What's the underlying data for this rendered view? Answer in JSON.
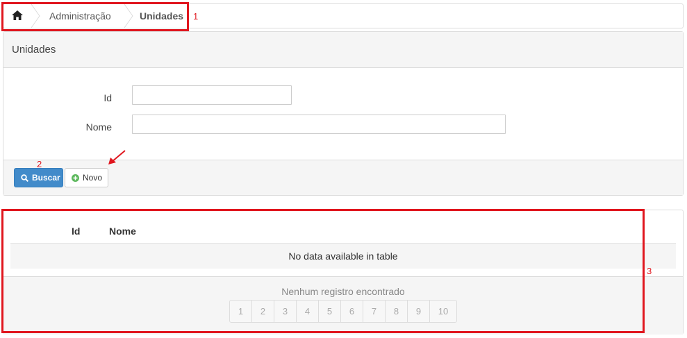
{
  "breadcrumb": {
    "home_icon": "home-icon",
    "items": [
      {
        "label": "Administração"
      },
      {
        "label": "Unidades"
      }
    ]
  },
  "panel": {
    "title": "Unidades",
    "fields": [
      {
        "label": "Id",
        "value": "",
        "placeholder": ""
      },
      {
        "label": "Nome",
        "value": "",
        "placeholder": ""
      }
    ],
    "buttons": {
      "search": {
        "label": "Buscar",
        "icon": "search-icon",
        "color": "#428bca"
      },
      "new": {
        "label": "Novo",
        "icon": "plus-circle-icon",
        "icon_color": "#5cb85c"
      }
    }
  },
  "table": {
    "columns": [
      "Id",
      "Nome"
    ],
    "empty_message": "No data available in table",
    "records_info": "Nenhum registro encontrado",
    "pages": [
      "1",
      "2",
      "3",
      "4",
      "5",
      "6",
      "7",
      "8",
      "9",
      "10"
    ]
  },
  "annotations": {
    "color": "#e0161e",
    "labels": [
      "1",
      "2",
      "3"
    ]
  }
}
